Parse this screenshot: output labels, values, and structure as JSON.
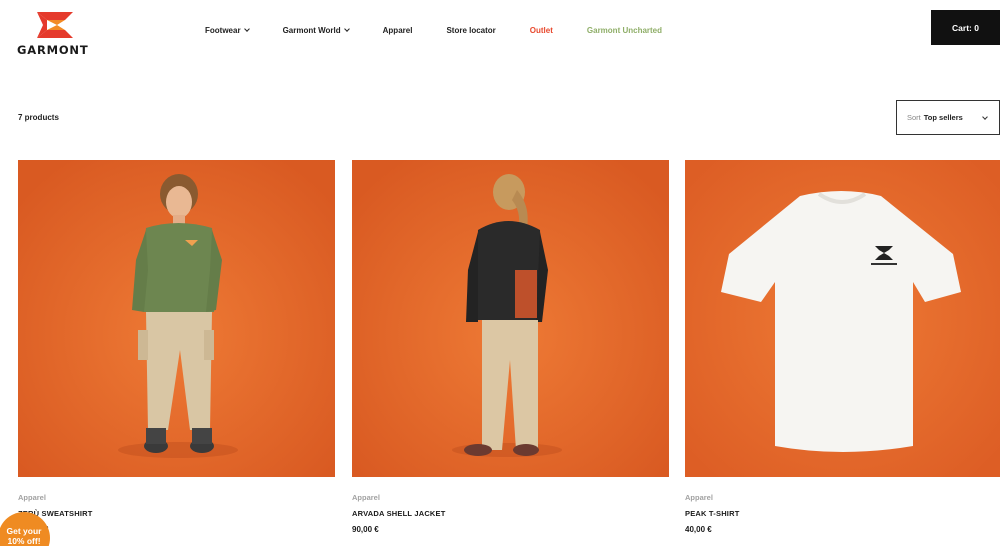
{
  "brand": {
    "name": "GARMONT",
    "logo_colors": [
      "#e53a2c",
      "#f28a25"
    ]
  },
  "nav": [
    {
      "label": "Footwear",
      "has_dropdown": true
    },
    {
      "label": "Garmont World",
      "has_dropdown": true
    },
    {
      "label": "Apparel",
      "has_dropdown": false
    },
    {
      "label": "Store locator",
      "has_dropdown": false
    },
    {
      "label": "Outlet",
      "has_dropdown": false,
      "color": "#e8492e"
    },
    {
      "label": "Garmont Uncharted",
      "has_dropdown": false,
      "color": "#8fae68"
    }
  ],
  "cart": {
    "label": "Cart: 0"
  },
  "toolbar": {
    "count": "7 products",
    "sort_label": "Sort",
    "sort_value": "Top sellers"
  },
  "products": [
    {
      "category": "Apparel",
      "name": "ZERÙ SWEATSHIRT",
      "price": "€",
      "image_icon": "person-sweatshirt-illustration"
    },
    {
      "category": "Apparel",
      "name": "ARVADA SHELL JACKET",
      "price": "90,00 €",
      "image_icon": "person-jacket-illustration"
    },
    {
      "category": "Apparel",
      "name": "PEAK T-SHIRT",
      "price": "40,00 €",
      "image_icon": "tshirt-illustration"
    }
  ],
  "badge": {
    "line1": "Get your",
    "line2": "10% off!"
  },
  "colors": {
    "product_bg": "#e86a2c",
    "badge": "#ef8b22",
    "cart_bg": "#111111"
  }
}
